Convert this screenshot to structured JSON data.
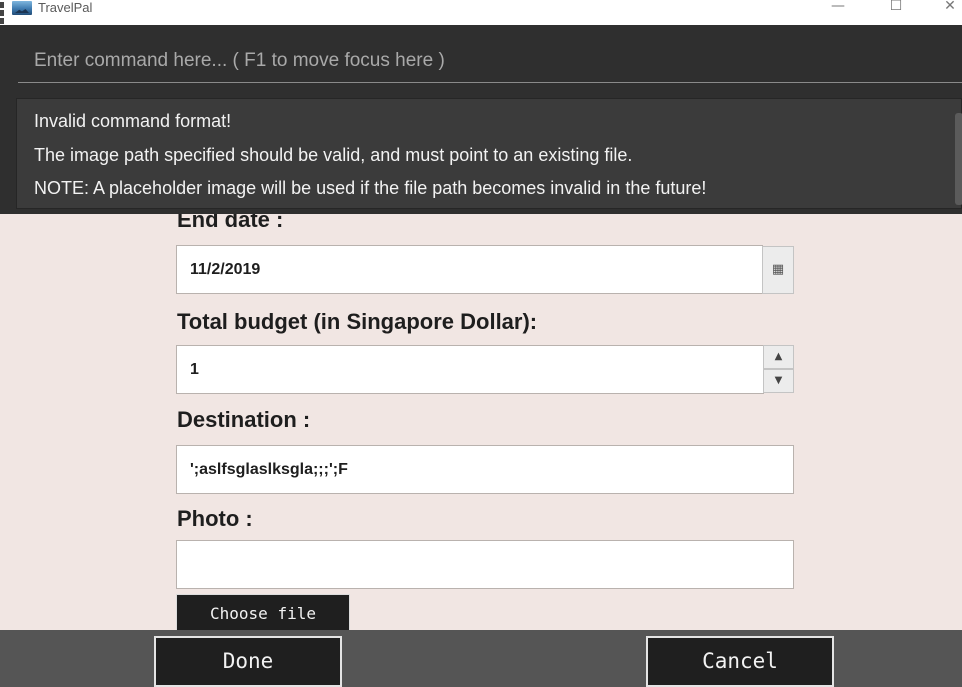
{
  "window": {
    "title": "TravelPal",
    "minimize_glyph": "—",
    "maximize_glyph": "☐",
    "close_glyph": "✕",
    "app_icon": "landscape-photo-icon"
  },
  "command": {
    "placeholder": "Enter command here... ( F1 to move focus here )",
    "value": ""
  },
  "result": {
    "lines": [
      "Invalid command format!",
      "The image path specified should be valid, and must point to an existing file.",
      "NOTE: A placeholder image will be used if the file path becomes invalid in the future!"
    ]
  },
  "form": {
    "end_date": {
      "label": "End date :",
      "value": "11/2/2019",
      "icon": "calendar-icon",
      "icon_glyph": "▦"
    },
    "budget": {
      "label": "Total budget (in Singapore Dollar):",
      "value": "1",
      "up_glyph": "▲",
      "down_glyph": "▼"
    },
    "destination": {
      "label": "Destination :",
      "value": "';aslfsglaslksgla;;;';F"
    },
    "photo": {
      "label": "Photo :",
      "value": "",
      "choose_label": "Choose file"
    }
  },
  "actions": {
    "done_label": "Done",
    "cancel_label": "Cancel"
  },
  "colors": {
    "command_bg": "#2f2f2f",
    "result_bg": "#3b3b3b",
    "form_bg": "#f1e6e3",
    "button_bg": "#1f1f1f",
    "bottom_bar_bg": "#555555"
  }
}
